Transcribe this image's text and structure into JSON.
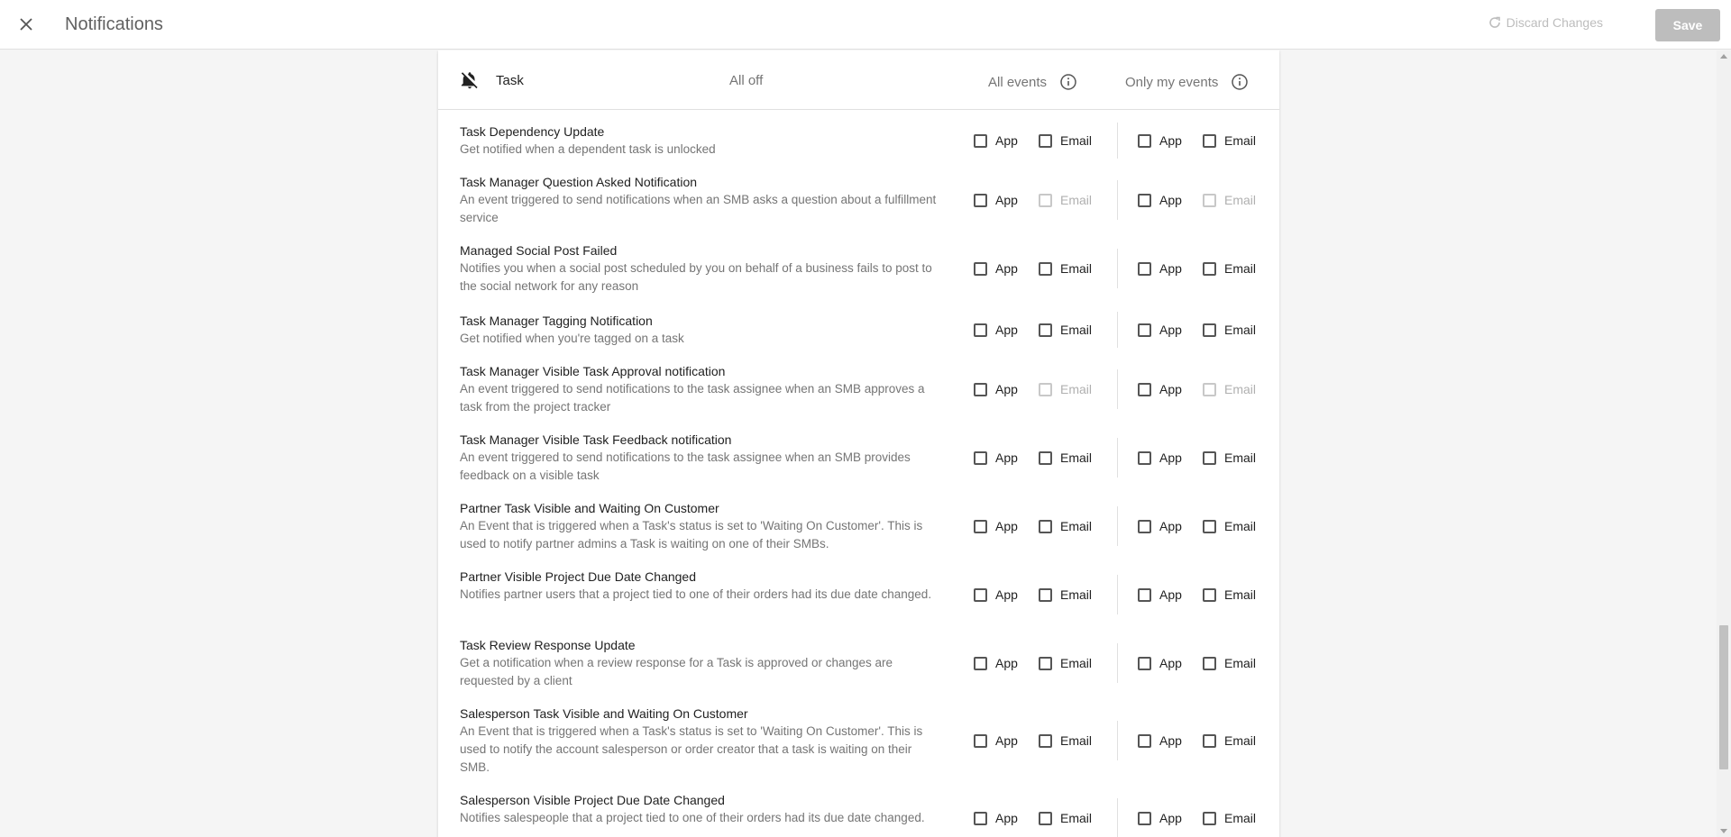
{
  "header": {
    "title": "Notifications",
    "discard_label": "Discard Changes",
    "save_label": "Save"
  },
  "section": {
    "title": "Task",
    "status": "All off",
    "all_events_label": "All events",
    "only_my_events_label": "Only my events"
  },
  "labels": {
    "app": "App",
    "email": "Email"
  },
  "rows": [
    {
      "title": "Task Dependency Update",
      "desc": "Get notified when a dependent task is unlocked",
      "email_disabled": false
    },
    {
      "title": "Task Manager Question Asked Notification",
      "desc": "An event triggered to send notifications when an SMB asks a question about a fulfillment service",
      "email_disabled": true
    },
    {
      "title": "Managed Social Post Failed",
      "desc": "Notifies you when a social post scheduled by you on behalf of a business fails to post to the social network for any reason",
      "email_disabled": false
    },
    {
      "title": "Task Manager Tagging Notification",
      "desc": "Get notified when you're tagged on a task",
      "email_disabled": false
    },
    {
      "title": "Task Manager Visible Task Approval notification",
      "desc": "An event triggered to send notifications to the task assignee when an SMB approves a task from the project tracker",
      "email_disabled": true
    },
    {
      "title": "Task Manager Visible Task Feedback notification",
      "desc": "An event triggered to send notifications to the task assignee when an SMB provides feedback on a visible task",
      "email_disabled": false
    },
    {
      "title": "Partner Task Visible and Waiting On Customer",
      "desc": "An Event that is triggered when a Task's status is set to 'Waiting On Customer'. This is used to notify partner admins a Task is waiting on one of their SMBs.",
      "email_disabled": false
    },
    {
      "title": "Partner Visible Project Due Date Changed",
      "desc": "Notifies partner users that a project tied to one of their orders had its due date changed.",
      "email_disabled": false
    },
    {
      "title": "Task Review Response Update",
      "desc": "Get a notification when a review response for a Task is approved or changes are requested by a client",
      "email_disabled": false
    },
    {
      "title": "Salesperson Task Visible and Waiting On Customer",
      "desc": "An Event that is triggered when a Task's status is set to 'Waiting On Customer'. This is used to notify the account salesperson or order creator that a task is waiting on their SMB.",
      "email_disabled": false
    },
    {
      "title": "Salesperson Visible Project Due Date Changed",
      "desc": "Notifies salespeople that a project tied to one of their orders had its due date changed.",
      "email_disabled": false
    }
  ]
}
